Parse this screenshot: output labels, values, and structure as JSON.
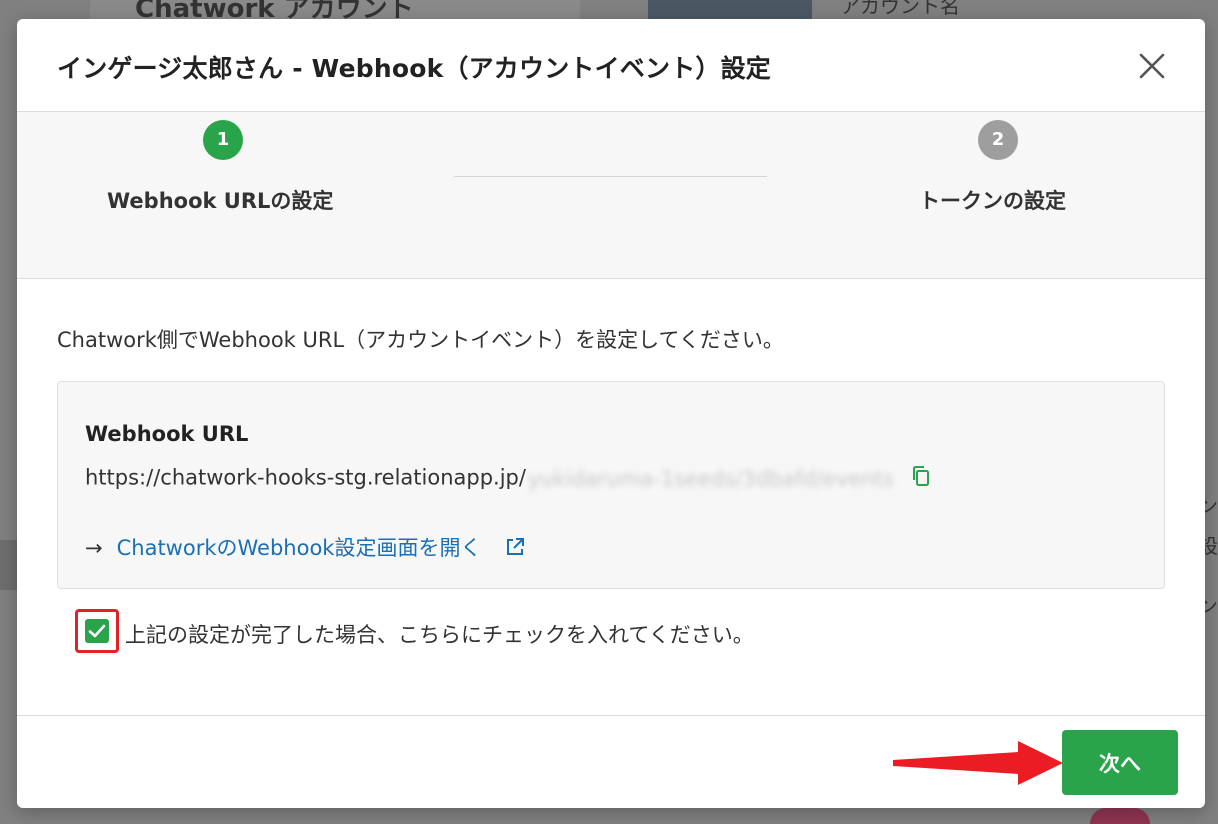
{
  "background": {
    "left_card_title": "Chatwork アカウント",
    "right_card_label": "アカウント名",
    "right_edge_texts": [
      "ン",
      "設",
      "ン"
    ]
  },
  "modal": {
    "title": "インゲージ太郎さん - Webhook（アカウントイベント）設定",
    "steps": [
      {
        "number": "1",
        "label": "Webhook URLの設定",
        "state": "active"
      },
      {
        "number": "2",
        "label": "トークンの設定",
        "state": "inactive"
      }
    ],
    "instruction": "Chatwork側でWebhook URL（アカウントイベント）を設定してください。",
    "webhook": {
      "heading": "Webhook URL",
      "url_prefix": "https://chatwork-hooks-stg.relationapp.jp/",
      "url_redacted": "yukidaruma-1seeds/3dbafd/events",
      "link_arrow": "→",
      "link_label": "ChatworkのWebhook設定画面を開く"
    },
    "confirmation": {
      "label": "上記の設定が完了した場合、こちらにチェックを入れてください。",
      "checked": true
    },
    "next_button": "次へ"
  },
  "colors": {
    "primary_green": "#2aa44a",
    "link_blue": "#1a6fb5",
    "highlight_red": "#e3212b",
    "inactive_grey": "#9e9e9e"
  },
  "icons": [
    "close-icon",
    "copy-icon",
    "external-link-icon",
    "checkmark-icon",
    "red-arrow-annotation"
  ]
}
